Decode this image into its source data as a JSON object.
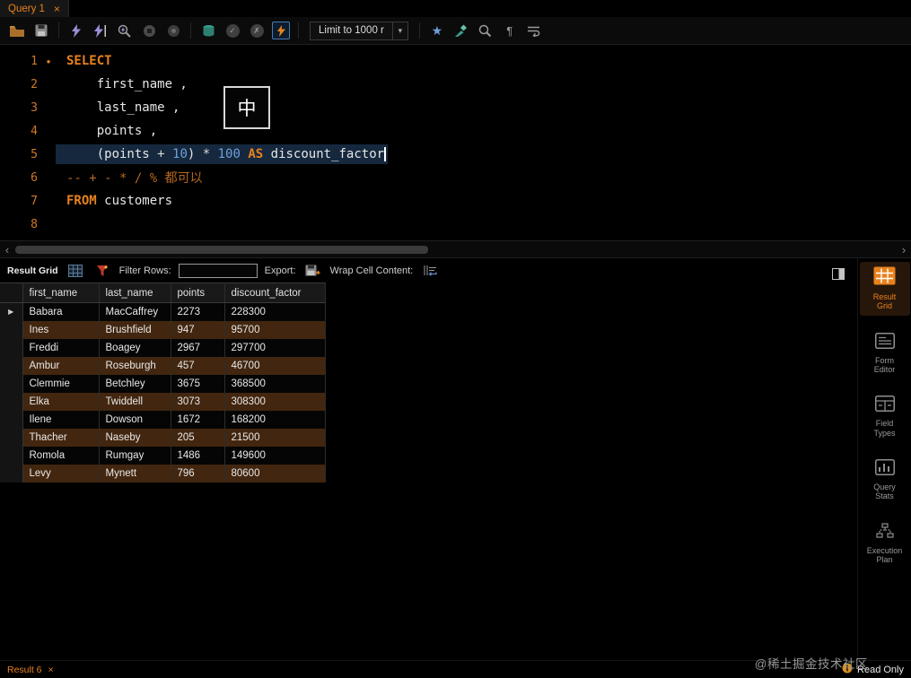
{
  "tab_bar": {
    "tabs": [
      {
        "label": "Query 1",
        "close": "×"
      }
    ]
  },
  "toolbar": {
    "limit_label": "Limit to 1000 r",
    "dropdown_arrow": "▾"
  },
  "icons": {
    "scroll_left": "‹",
    "scroll_right": "›",
    "check": "✓",
    "cross": "✗",
    "star": "★",
    "pilcrow": "¶",
    "marker_dot": "●",
    "selected_row_arrow": "▶"
  },
  "editor": {
    "lines": [
      {
        "num": "1",
        "marker": true,
        "segments": [
          [
            "kw",
            "SELECT"
          ]
        ]
      },
      {
        "num": "2",
        "segments": [
          [
            "pl",
            "    first_name ,"
          ]
        ]
      },
      {
        "num": "3",
        "segments": [
          [
            "pl",
            "    last_name ,"
          ]
        ]
      },
      {
        "num": "4",
        "segments": [
          [
            "pl",
            "    points ,"
          ]
        ]
      },
      {
        "num": "5",
        "highlight": true,
        "cursor": true,
        "segments": [
          [
            "pl",
            "    (points "
          ],
          [
            "op",
            "+"
          ],
          [
            "pl",
            " "
          ],
          [
            "nm",
            "10"
          ],
          [
            "pl",
            ") "
          ],
          [
            "op",
            "*"
          ],
          [
            "pl",
            " "
          ],
          [
            "nm",
            "100"
          ],
          [
            "pl",
            " "
          ],
          [
            "kw",
            "AS"
          ],
          [
            "pl",
            " discount_factor"
          ]
        ]
      },
      {
        "num": "6",
        "segments": [
          [
            "cm",
            "-- + - * / % 都可以"
          ]
        ]
      },
      {
        "num": "7",
        "segments": [
          [
            "kw",
            "FROM"
          ],
          [
            "pl",
            " customers"
          ]
        ]
      },
      {
        "num": "8",
        "segments": []
      }
    ]
  },
  "ime_overlay": {
    "char": "中"
  },
  "result_toolbar": {
    "title": "Result Grid",
    "filter_label": "Filter Rows:",
    "filter_value": "",
    "export_label": "Export:",
    "wrap_label": "Wrap Cell Content:"
  },
  "table": {
    "columns": [
      "first_name",
      "last_name",
      "points",
      "discount_factor"
    ],
    "rows": [
      [
        "Babara",
        "MacCaffrey",
        "2273",
        "228300"
      ],
      [
        "Ines",
        "Brushfield",
        "947",
        "95700"
      ],
      [
        "Freddi",
        "Boagey",
        "2967",
        "297700"
      ],
      [
        "Ambur",
        "Roseburgh",
        "457",
        "46700"
      ],
      [
        "Clemmie",
        "Betchley",
        "3675",
        "368500"
      ],
      [
        "Elka",
        "Twiddell",
        "3073",
        "308300"
      ],
      [
        "Ilene",
        "Dowson",
        "1672",
        "168200"
      ],
      [
        "Thacher",
        "Naseby",
        "205",
        "21500"
      ],
      [
        "Romola",
        "Rumgay",
        "1486",
        "149600"
      ],
      [
        "Levy",
        "Mynett",
        "796",
        "80600"
      ]
    ],
    "selected_row": 0
  },
  "sidebar": {
    "items": [
      {
        "line1": "Result",
        "line2": "Grid",
        "active": true
      },
      {
        "line1": "Form",
        "line2": "Editor",
        "active": false
      },
      {
        "line1": "Field",
        "line2": "Types",
        "active": false
      },
      {
        "line1": "Query",
        "line2": "Stats",
        "active": false
      },
      {
        "line1": "Execution",
        "line2": "Plan",
        "active": false
      }
    ]
  },
  "status_bar": {
    "result_tab": "Result 6",
    "close": "×",
    "read_only": "Read Only"
  },
  "watermark": "@稀土掘金技术社区"
}
